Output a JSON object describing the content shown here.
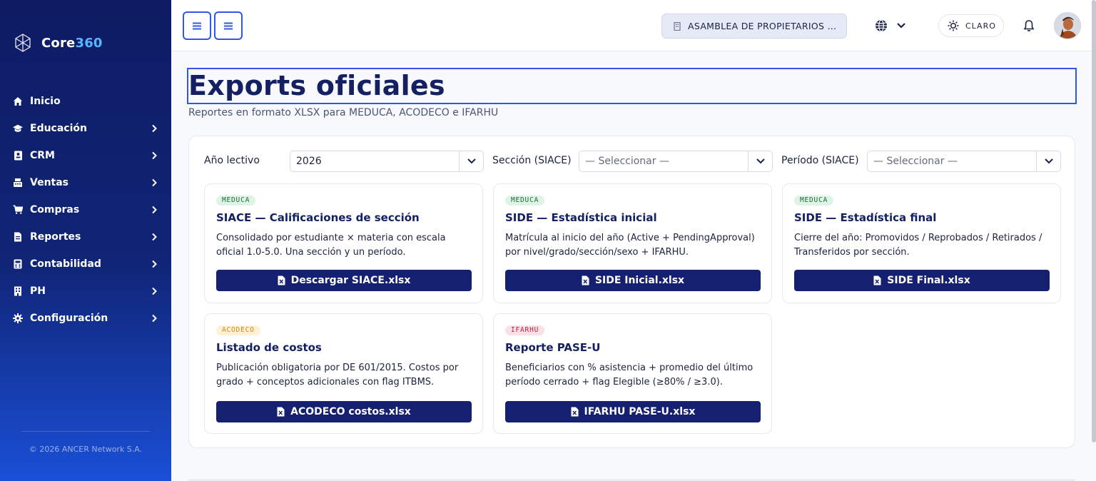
{
  "brand": {
    "name_part1": "Core",
    "name_part2": "360"
  },
  "sidebar": {
    "items": [
      {
        "label": "Inicio",
        "icon": "home-icon",
        "has_submenu": false
      },
      {
        "label": "Educación",
        "icon": "graduation-cap-icon",
        "has_submenu": true
      },
      {
        "label": "CRM",
        "icon": "contact-card-icon",
        "has_submenu": true
      },
      {
        "label": "Ventas",
        "icon": "cash-register-icon",
        "has_submenu": true
      },
      {
        "label": "Compras",
        "icon": "shopping-cart-icon",
        "has_submenu": true
      },
      {
        "label": "Reportes",
        "icon": "report-file-icon",
        "has_submenu": true
      },
      {
        "label": "Contabilidad",
        "icon": "calculator-icon",
        "has_submenu": true
      },
      {
        "label": "PH",
        "icon": "building-icon",
        "has_submenu": true
      },
      {
        "label": "Configuración",
        "icon": "gear-icon",
        "has_submenu": true
      }
    ],
    "footer": "© 2026 ANCER Network S.A."
  },
  "topbar": {
    "org_selector": "ASAMBLEA DE PROPIETARIOS DE …",
    "theme_label": "CLARO"
  },
  "page": {
    "title": "Exports oficiales",
    "subtitle": "Reportes en formato XLSX para MEDUCA, ACODECO e IFARHU"
  },
  "filters": {
    "year_label": "Año lectivo",
    "year_value": "2026",
    "section_label": "Sección (SIACE)",
    "section_value": "— Seleccionar —",
    "period_label": "Período (SIACE)",
    "period_value": "— Seleccionar —"
  },
  "cards": [
    {
      "badge": "MEDUCA",
      "title": "SIACE — Calificaciones de sección",
      "desc": "Consolidado por estudiante × materia con escala oficial 1.0-5.0. Una sección y un período.",
      "button": "Descargar SIACE.xlsx"
    },
    {
      "badge": "MEDUCA",
      "title": "SIDE — Estadística inicial",
      "desc": "Matrícula al inicio del año (Active + PendingApproval) por nivel/grado/sección/sexo + IFARHU.",
      "button": "SIDE Inicial.xlsx"
    },
    {
      "badge": "MEDUCA",
      "title": "SIDE — Estadística final",
      "desc": "Cierre del año: Promovidos / Reprobados / Retirados / Transferidos por sección.",
      "button": "SIDE Final.xlsx"
    },
    {
      "badge": "ACODECO",
      "title": "Listado de costos",
      "desc": "Publicación obligatoria por DE 601/2015. Costos por grado + conceptos adicionales con flag ITBMS.",
      "button": "ACODECO costos.xlsx"
    },
    {
      "badge": "IFARHU",
      "title": "Reporte PASE-U",
      "desc": "Beneficiarios con % asistencia + promedio del último período cerrado + flag Elegible (≥80% / ≥3.0).",
      "button": "IFARHU PASE-U.xlsx"
    }
  ],
  "colors": {
    "sidebar_top": "#0e1b63",
    "sidebar_bottom": "#1a4fd6",
    "primary_button": "#152070",
    "accent_border": "#2f58e4",
    "badge_meduca": "#dff4e6",
    "badge_acodeco": "#fff0d6",
    "badge_ifarhu": "#fbe0e6"
  }
}
